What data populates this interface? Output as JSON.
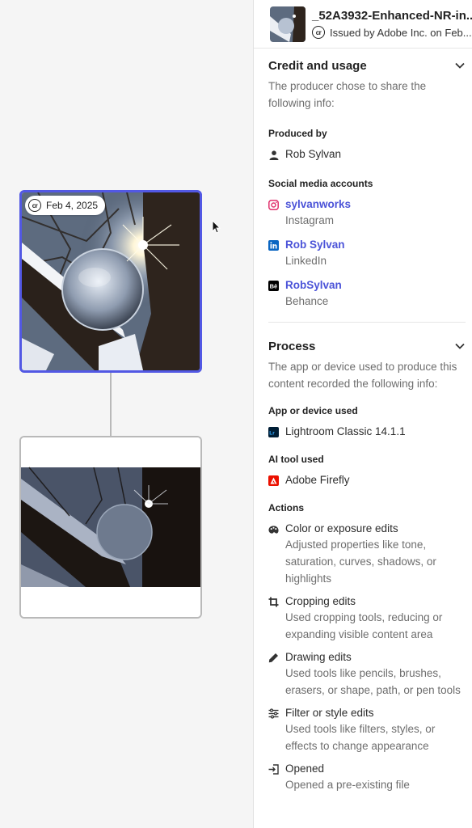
{
  "canvas": {
    "current_node": {
      "date": "Feb 4, 2025"
    }
  },
  "header": {
    "file_name": "_52A3932-Enhanced-NR-in...",
    "issuer": "Issued by Adobe Inc. on Feb..."
  },
  "credit": {
    "title": "Credit and usage",
    "description": "The producer chose to share the following info:",
    "produced_by_label": "Produced by",
    "producer": "Rob Sylvan",
    "social_label": "Social media accounts",
    "accounts": [
      {
        "handle": "sylvanworks",
        "platform": "Instagram",
        "icon": "instagram-icon",
        "color": "#e1306c"
      },
      {
        "handle": "Rob Sylvan",
        "platform": "LinkedIn",
        "icon": "linkedin-icon",
        "color": "#0a66c2"
      },
      {
        "handle": "RobSylvan",
        "platform": "Behance",
        "icon": "behance-icon",
        "color": "#000000"
      }
    ]
  },
  "process": {
    "title": "Process",
    "description": "The app or device used to produce this content recorded the following info:",
    "app_label": "App or device used",
    "app": "Lightroom Classic 14.1.1",
    "ai_label": "AI tool used",
    "ai_tool": "Adobe Firefly",
    "actions_label": "Actions",
    "actions": [
      {
        "title": "Color or exposure edits",
        "desc": "Adjusted properties like tone, saturation, curves, shadows, or highlights",
        "icon": "palette-icon"
      },
      {
        "title": "Cropping edits",
        "desc": "Used cropping tools, reducing or expanding visible content area",
        "icon": "crop-icon"
      },
      {
        "title": "Drawing edits",
        "desc": "Used tools like pencils, brushes, erasers, or shape, path, or pen tools",
        "icon": "pencil-icon"
      },
      {
        "title": "Filter or style edits",
        "desc": "Used tools like filters, styles, or effects to change appearance",
        "icon": "sliders-icon"
      },
      {
        "title": "Opened",
        "desc": "Opened a pre-existing file",
        "icon": "import-icon"
      }
    ]
  },
  "colors": {
    "accent": "#5258e4",
    "link": "#4b53d8"
  }
}
